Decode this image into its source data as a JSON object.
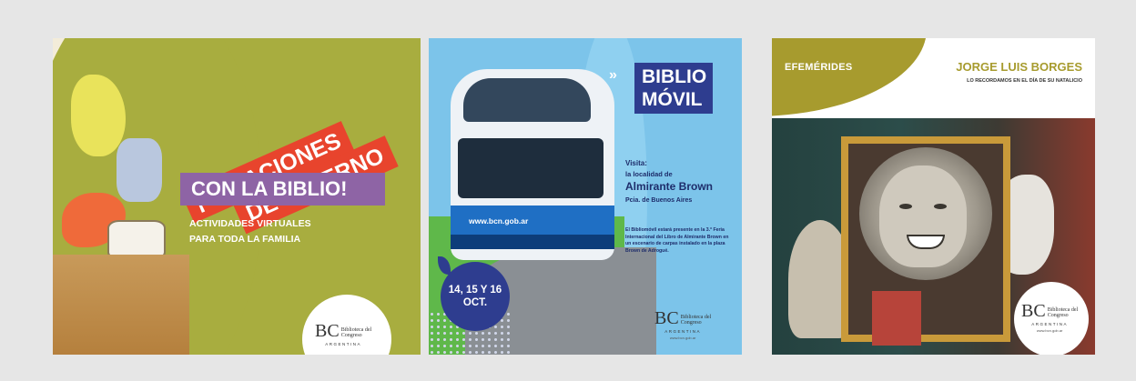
{
  "card1": {
    "line1": "¡VACACIONES",
    "line2": "DE INVIERNO",
    "line3": "CON LA BIBLIO!",
    "subtitle_line1": "ACTIVIDADES VIRTUALES",
    "subtitle_line2": "PARA TODA LA FAMILIA",
    "logo": {
      "bc": "BC",
      "name_line1": "Biblioteca del",
      "name_line2": "Congreso",
      "country": "ARGENTINA"
    }
  },
  "card2": {
    "title_line1": "BIBLIO",
    "title_line2": "MÓVIL",
    "chevron": "»",
    "visita": "Visita:",
    "localidad": "la localidad de",
    "place": "Almirante Brown",
    "province": "Pcia. de Buenos Aires",
    "description": "El Bibliomóvil estará presente en la 3.ª Feria Internacional del Libro de Almirante Brown en un escenario de carpas instalado en la plaza Brown de Adrogué.",
    "bus_url": "www.bcn.gob.ar",
    "date_line1": "14, 15 Y 16",
    "date_line2": "OCT.",
    "logo": {
      "bc": "BC",
      "name_line1": "Biblioteca del",
      "name_line2": "Congreso",
      "country": "ARGENTINA",
      "url": "www.bcn.gob.ar"
    }
  },
  "card3": {
    "tag": "EFEMÉRIDES",
    "name": "JORGE LUIS BORGES",
    "subtitle": "LO RECORDAMOS EN EL DÍA DE SU NATALICIO",
    "logo": {
      "bc": "BC",
      "name_line1": "Biblioteca del",
      "name_line2": "Congreso",
      "country": "ARGENTINA",
      "url": "www.bcn.gob.ar"
    }
  },
  "colors": {
    "olive_green": "#a8ad3f",
    "red_banner": "#e8442d",
    "purple_banner": "#8e64a5",
    "navy": "#2e3d8f",
    "sky_blue": "#7cc4ea",
    "gold": "#a79b2e"
  }
}
